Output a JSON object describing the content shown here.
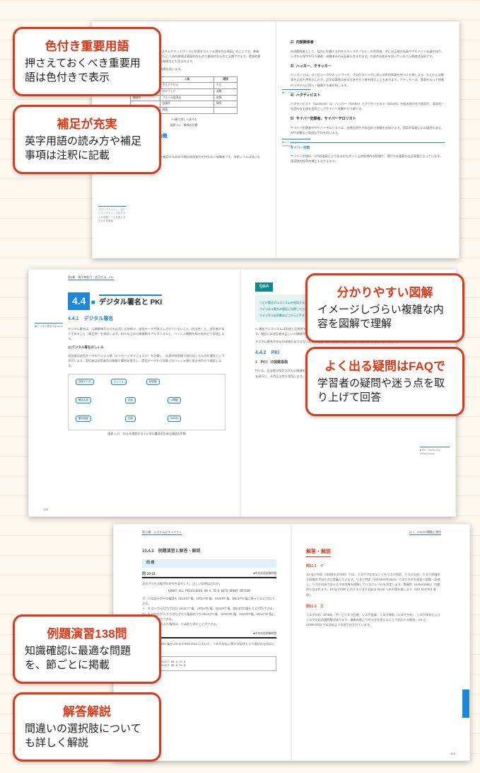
{
  "callouts": {
    "c1": {
      "title": "色付き重要用語",
      "desc": "押さえておくべき重要用語は色付きで表示"
    },
    "c2": {
      "title": "補足が充実",
      "desc": "英字用語の読み方や補足事項は注釈に記載"
    },
    "c3": {
      "title": "分かりやすい図解",
      "desc": "イメージしづらい複雑な内容を図解で理解"
    },
    "c4": {
      "title": "よく出る疑問はFAQで",
      "desc": "学習者の疑問や迷う点を取り上げて回答"
    },
    "c5": {
      "title": "例題演習138問",
      "desc": "知識確認に最適な問題を、節ごとに掲載"
    },
    "c6": {
      "title": "解答解説",
      "desc": "間違いの選択肢についても詳しく解説"
    }
  },
  "spread1": {
    "left": {
      "chapter_label": "威と攻撃者",
      "sub1": "3.1.2　攻撃者の種類と動機",
      "margin1": "スクリプトキディ　スクリプトキディ：プログラムや攻撃ツールを用いるだけの攻撃者",
      "sub2": "1）スクリプトキディ",
      "body2": "スクリプトキディは、既存の攻撃ツールを使用するのみで独自の技術力を持たない攻撃者です。技術レベルは低いものの数が多いため無視できません。",
      "caption": "図表 3-1　脅威の分類",
      "table": {
        "head": [
          "",
          "人為",
          "環境"
        ],
        "rows": [
          [
            "意図的",
            "不正アクセス",
            "不正"
          ],
          [
            "",
            "マルウェア",
            "盗難"
          ],
          [
            "偶発的",
            "ファイル誤消去",
            "故障"
          ],
          [
            "",
            "誤操作",
            "障害"
          ],
          [
            "",
            "障害",
            ""
          ]
        ],
        "note": "※3章で詳しく述べる"
      }
    },
    "right": {
      "sub1": "2）内部関係者",
      "body1": "内部関係者として、社内に在籍する内外スタッフや「もと」の利用者、中には正規の社員やアルバイト社員のほか、システム保守を行う業者、退職済みの元社員も含まれます。内部の仕組みを知っているぶん脅威は深刻です。",
      "sub2": "3）ハッカー、クラッカー",
      "body2": "ハッカーとは、コンピュータやネットワーク、プログラミングに深い技術的知識を持つ人を指します。もともとは敬意を込めた呼称でしたが、近年は悪意のある行為を行う者を指すこともあります。クラッカーは、悪意をもって他者のシステムに侵入・破壊する者を指します。",
      "sub3": "4）ハクティビスト",
      "body3": "ハクティビスト（hacktivist）は、ハッカー（hacker）とアクティビスト（activist）を組み合わせた造語で、政治的・社会的な主張を目的としてサイバー攻撃を行う者です。",
      "sub4": "5）サイバー犯罪者、サイバーテロリスト",
      "body4": "サイバー犯罪者やサイバーテロリストは、金銭目的やテロ目的で攻撃を仕掛けます。国家が背後にいる場合もあり、APT攻撃など高度な手口を用います。",
      "margin1": "▶ハッカー／クラッカー",
      "margin2": "▶ハクティビスト hacktivist",
      "footer_sub": "サイバー空間",
      "footer_body": "サイバー空間は、ICTの進展により生まれたネット上の仮想的な空間で、現代では重要な社会基盤となっています。国家間の紛争の場ともなりえます。"
    }
  },
  "spread2": {
    "left": {
      "header": "第4章　電子商取引・認可方法、PKI",
      "secnum": "4.4",
      "sectitle": "デジタル署名と PKI",
      "sub1": "4.4.1　デジタル署名",
      "body1": "デジタル署名は、公開鍵暗号方式を応用した技術で、送信データが改ざんされていないこと（完全性）と、送信者が本人であること（真正性）を保証します。RSAなどの公開鍵暗号アルゴリズムと、ハッシュ関数を組み合わせて実現します。",
      "margin1": "▶デジタル署名 signature",
      "item1": "(1)デジタル署名のしくみ",
      "item_body": "送信者は送信データのハッシュ値（メッセージダイジェスト）を計算し、自身の秘密鍵で暗号化したものを署名として添付します。受信者は送信者の公開鍵で署名を復号し、受信データから計算したハッシュ値と突き合わせて検証します。",
      "diagram_caption": "図表 4-21　RSA を使用するデジタル署名の生成と検証の手順"
    },
    "right": {
      "qa": "Q&A",
      "q1": "①どの署名アルゴリズムを使用するかはどう決めるのでしょうか？",
      "q2": "②デジタル署名の検証に失敗したら改ざんされたのか、経路で本人でないことがあるのでしょうか？",
      "q3": "③デジタル証明書はどこから入手するのですか？",
      "sub2": "4.4.2　PKI",
      "item2": "1　PKI：公開鍵基盤",
      "body2": "PKI は、正当性が保証された公開鍵を配布するための基盤（インフラストラクチャ）です。認証局（CA）が公開鍵証明書を発行し、その正当性を保証します。",
      "margin2": "▶PKI：Public Key Infrastructure"
    }
  },
  "spread3": {
    "left": {
      "header": "第10章　システムセキュリティ",
      "sub": "10.4.2　例題演習と解答・解説",
      "prob_label": "問 題",
      "prob_no": "問 10-11",
      "prob_src": "■中央処理試験問題",
      "prob_body": "次のアクセス権付与命令を実行した。正しい説明はどれか。",
      "sql": "GRANT ALL PRIVILEGES ON A TO B WITH GRANT OPTION",
      "opts": "ア　A は自分が持つ権限を SELECT 権、UPDATE 権、INSERT 権、DELETE 権に限って B に付与できる。\nイ　B は A から付与された SELECT 権、UPDATE 権、INSERT 権、DELETE 権を C に付与できる。\nウ　B は自分が A から付与された権限のうち SELECT 権、UPDATE 権、INSERT 権、DELETE 権に限り、C に付与できる。\nエ　A が B に与えた権限は、A は取り消すことができる。",
      "prob2_no": "問 10-12",
      "prob2_body": "JIS Q 27000:2014 及び JIS Q 27001:2014 において、リスク対応に関する記述として適切なものはどれか。",
      "code_block": "ア GRANT SELECT ON A TO B\nイ GRANT SELECT ON A TO B"
    },
    "right": {
      "header": "11.1　ISMSの構築と運用",
      "ans_label": "解答・解説",
      "a1_no": "問11-1　イ",
      "a1_body": "JIS Q 27000（ISO/IEC 27000）では、リスクアセスメントをリスク特定、リスク分析、リスク評価の３段階のプロセスと定義しています。リスク特定（risk identification）ではリスクを発見・認識・記述し、リスク分析ではリスクの性質を理解してリスクレベルを決定します。脆弱性（vulnerability）の識別も含まれます。JIS Q 27000 におけるリスク対応は threat への対策を指します（ISO Q 27001 参照）。",
      "a2_no": "問11-2　エ",
      "a2_body": "リスク対応（JP405、ア）とリスク回避、リスク低減、リスク移転（リスク共有）、リスク保有というリスク対応の選択肢があります。事象の起こりやすさを変えることで対応する場合、JIS Q 31000:2010 では次のような形で示されています。"
    }
  }
}
